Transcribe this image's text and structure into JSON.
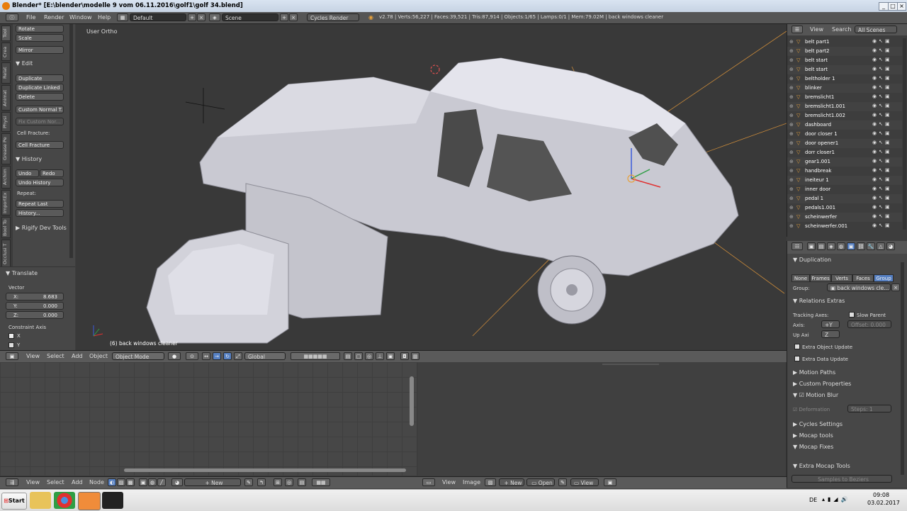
{
  "window": {
    "title": "Blender* [E:\\blender\\modelle 9 vom 06.11.2016\\golf1\\golf 34.blend]"
  },
  "header": {
    "menus": [
      "File",
      "Render",
      "Window",
      "Help"
    ],
    "screen_layout": "Default",
    "scene": "Scene",
    "render_engine": "Cycles Render",
    "stats": "v2.78 | Verts:56,227 | Faces:39,521 | Tris:87,914 | Objects:1/65 | Lamps:0/1 | Mem:79.02M | back windows cleaner"
  },
  "tool_tabs": [
    "Tool",
    "Crea",
    "Relat",
    "Animat",
    "Physi",
    "Grease Pe",
    "Archim",
    "ImportEx",
    "Bool To",
    "Occlusi T"
  ],
  "tool_shelf": {
    "buttons_top": [
      "Rotate",
      "Scale"
    ],
    "mirror": "Mirror",
    "edit_header": "Edit",
    "edit_buttons": [
      "Duplicate",
      "Duplicate Linked",
      "Delete"
    ],
    "custom_normal": "Custom Normal T...",
    "fix_custom": "Fix Custom Nor...",
    "cell_fracture_label": "Cell Fracture:",
    "cell_fracture_btn": "Cell Fracture",
    "history_header": "History",
    "undo": "Undo",
    "redo": "Redo",
    "undo_history": "Undo History",
    "repeat_label": "Repeat:",
    "repeat_last": "Repeat Last",
    "history_btn": "History...",
    "rigify": "Rigify Dev Tools"
  },
  "operator": {
    "title": "Translate",
    "vector_label": "Vector",
    "x_label": "X:",
    "x": "8.683",
    "y_label": "Y:",
    "y": "0.000",
    "z_label": "Z:",
    "z": "0.000",
    "constraint_label": "Constraint Axis",
    "cx": "X",
    "cy": "Y"
  },
  "viewport": {
    "view_label": "User Ortho",
    "object_label": "(6) back windows cleaner"
  },
  "viewport_header": {
    "menus": [
      "View",
      "Select",
      "Add",
      "Object"
    ],
    "mode": "Object Mode",
    "orientation": "Global"
  },
  "node_header": {
    "menus": [
      "View",
      "Select",
      "Add",
      "Node"
    ],
    "new_btn": "New"
  },
  "image_header": {
    "menus": [
      "View",
      "Image"
    ],
    "new_btn": "New",
    "open_btn": "Open",
    "view_btn": "View"
  },
  "outliner": {
    "menus": [
      "View",
      "Search"
    ],
    "filter": "All Scenes",
    "items": [
      "belt part1",
      "belt part2",
      "belt start",
      "belt start",
      "beltholder 1",
      "blinker",
      "bremslicht1",
      "bremslicht1.001",
      "bremslicht1.002",
      "dashboard",
      "door closer 1",
      "door opener1",
      "dorr closer1",
      "gear1.001",
      "handbreak",
      "ineiteur 1",
      "inner door",
      "pedal 1",
      "pedals1.001",
      "scheinwerfer",
      "scheinwerfer.001"
    ]
  },
  "properties": {
    "duplication_header": "Duplication",
    "dup_options": [
      "None",
      "Frames",
      "Verts",
      "Faces",
      "Group"
    ],
    "group_label": "Group:",
    "group_value": "back windows cle...",
    "relations_header": "Relations Extras",
    "tracking_label": "Tracking Axes:",
    "slow_parent": "Slow Parent",
    "axis_label": "Axis:",
    "axis_value": "+Y",
    "offset": "Offset:",
    "offset_value": "0.000",
    "up_label": "Up Axi",
    "up_value": "Z",
    "extra_obj": "Extra Object Update",
    "extra_data": "Extra Data Update",
    "sections": [
      "Motion Paths",
      "Custom Properties"
    ],
    "motion_blur": "Motion Blur",
    "deformation": "Deformation",
    "steps": "Steps:",
    "steps_value": "1",
    "sections2": [
      "Cycles Settings",
      "Mocap tools",
      "Mocap Fixes"
    ],
    "extra_mocap": "Extra Mocap Tools",
    "samples": "Samples to Beziers"
  },
  "taskbar": {
    "start": "Start",
    "lang": "DE",
    "time": "09:08",
    "date": "03.02.2017"
  }
}
